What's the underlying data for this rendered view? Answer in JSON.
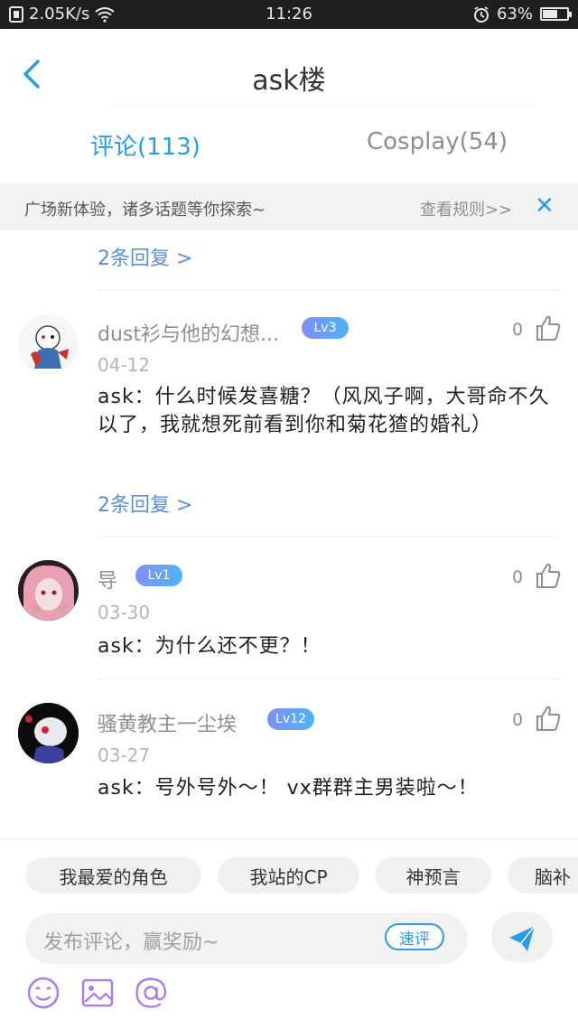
{
  "status_bar": {
    "speed": "2.05K/s",
    "time": "11:26",
    "battery": "63%",
    "battery_level": 0.63
  },
  "nav": {
    "title": "ask楼"
  },
  "tabs": [
    {
      "label": "评论(113)"
    },
    {
      "label": "Cosplay(54)"
    }
  ],
  "notice": {
    "text": "广场新体验，诸多话题等你探索~",
    "rules": "查看规则>>",
    "close": "✕"
  },
  "comments": [
    {
      "replies": "2条回复 >"
    },
    {
      "username": "dust衫与他的幻想...",
      "level": "Lv3",
      "date": "04-12",
      "likes": "0",
      "text": "ask：什么时候发喜糖？（风风子啊，大哥命不久以了，我就想死前看到你和菊花猹的婚礼）",
      "replies": "2条回复 >"
    },
    {
      "username": "导",
      "level": "Lv1",
      "date": "03-30",
      "likes": "0",
      "text": "ask：为什么还不更？！"
    },
    {
      "username": "骚黄教主一尘埃",
      "level": "Lv12",
      "date": "03-27",
      "likes": "0",
      "text": "ask：号外号外～！ vx群群主男装啦～！"
    }
  ],
  "chips": [
    "我最爱的角色",
    "我站的CP",
    "神预言",
    "脑补"
  ],
  "composer": {
    "placeholder": "发布评论，赢奖励~",
    "speed_label": "速评"
  },
  "colors": {
    "accent": "#2a9ce0",
    "link": "#5a8fd8"
  }
}
